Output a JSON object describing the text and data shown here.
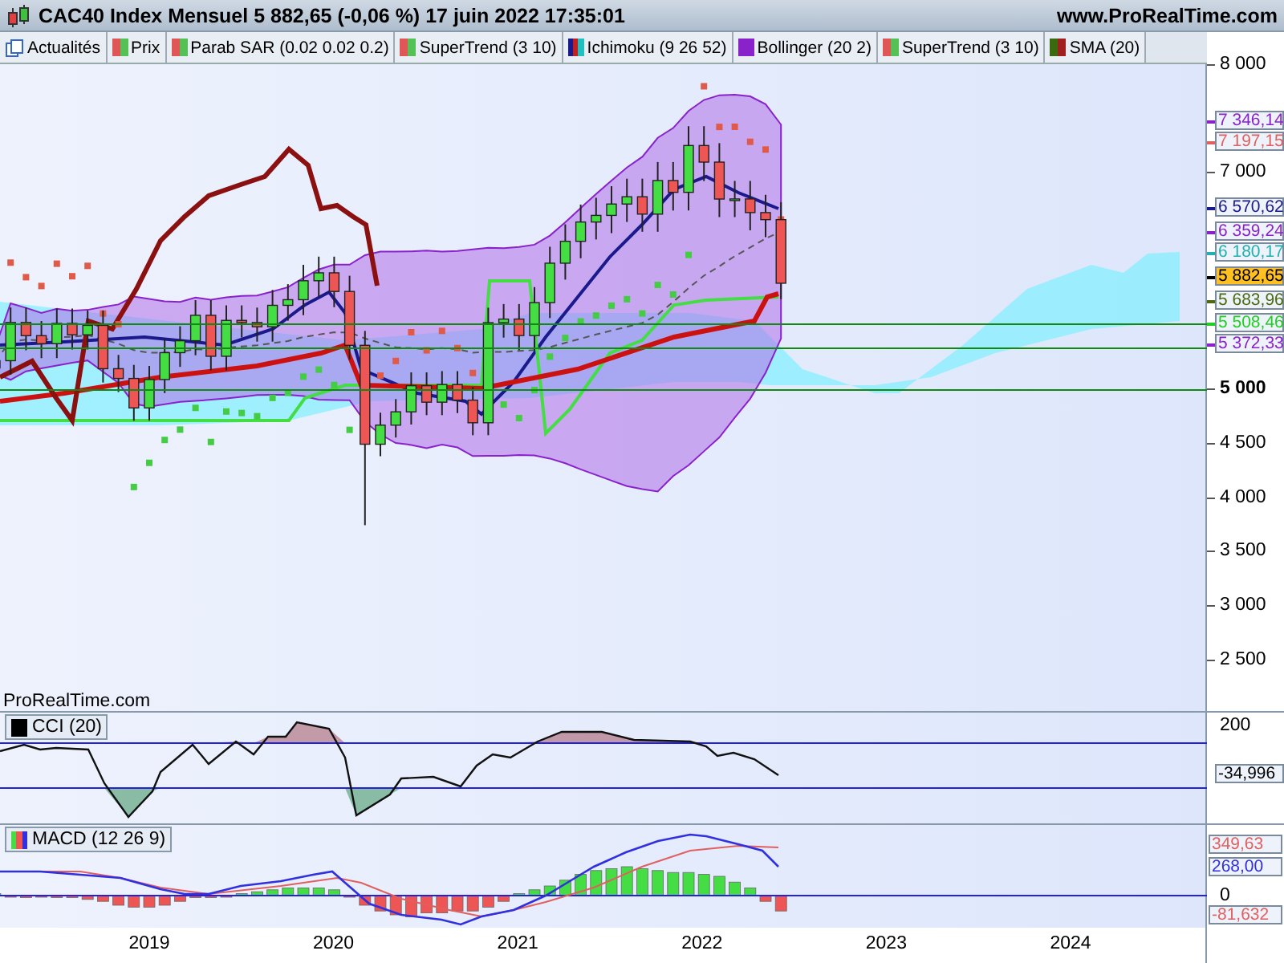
{
  "window": {
    "title": "CAC40 Index Mensuel 5 882,65 (-0,06 %) 17 juin 2022 17:35:01",
    "site": "www.ProRealTime.com"
  },
  "toolbar": {
    "news_button": "Actualités",
    "indicators": [
      {
        "label": "Prix",
        "swatch": [
          {
            "color": "#e05555"
          },
          {
            "color": "#55c055"
          }
        ]
      },
      {
        "label": "Parab SAR (0.02 0.02 0.2)",
        "swatch": [
          {
            "color": "#e05555"
          },
          {
            "color": "#55c055"
          }
        ]
      },
      {
        "label": "SuperTrend (3 10)",
        "swatch": [
          {
            "color": "#e05555"
          },
          {
            "color": "#55c055"
          }
        ]
      },
      {
        "label": "Ichimoku (9 26 52)",
        "swatch": [
          {
            "color": "#1a1a8c"
          },
          {
            "color": "#c02020"
          },
          {
            "color": "#20c0c0"
          }
        ]
      },
      {
        "label": "Bollinger (20 2)",
        "swatch": [
          {
            "color": "#8a22cc"
          }
        ]
      },
      {
        "label": "SuperTrend (3 10)",
        "swatch": [
          {
            "color": "#e05555"
          },
          {
            "color": "#55c055"
          }
        ]
      },
      {
        "label": "SMA (20)",
        "swatch": [
          {
            "color": "#3a6a10"
          },
          {
            "color": "#a02020"
          }
        ]
      }
    ]
  },
  "price_panel": {
    "source_label": "ProRealTime.com",
    "axis_labels": [
      {
        "label": "8 000",
        "bold": false
      },
      {
        "label": "7 000",
        "bold": false
      },
      {
        "label": "5 000",
        "bold": true
      },
      {
        "label": "4 500",
        "bold": false
      },
      {
        "label": "4 000",
        "bold": false
      },
      {
        "label": "3 500",
        "bold": false
      },
      {
        "label": "3 000",
        "bold": false
      },
      {
        "label": "2 500",
        "bold": false
      }
    ],
    "value_tags": [
      {
        "label": "7 346,14",
        "color": "#8a22cc",
        "highlighted": false
      },
      {
        "label": "7 197,15",
        "color": "#e06060",
        "highlighted": false
      },
      {
        "label": "6 570,62",
        "color": "#1a1a8c",
        "highlighted": false
      },
      {
        "label": "6 359,24",
        "color": "#8a22cc",
        "highlighted": false
      },
      {
        "label": "6 180,17",
        "color": "#20b0b0",
        "highlighted": false
      },
      {
        "label": "5 882,65",
        "color": "#000000",
        "highlighted": true
      },
      {
        "label": "5 683,96",
        "color": "#4a6a10",
        "highlighted": false
      },
      {
        "label": "5 508,46",
        "color": "#20d020",
        "highlighted": false
      },
      {
        "label": "5 372,33",
        "color": "#8a22cc",
        "highlighted": false
      }
    ]
  },
  "cci_panel": {
    "legend": "CCI (20)",
    "axis_labels": [
      "200"
    ],
    "value_tag": "-34,996"
  },
  "macd_panel": {
    "legend": "MACD (12 26 9)",
    "axis_labels": [
      "0"
    ],
    "value_tags": [
      {
        "label": "349,63",
        "color": "#e06060"
      },
      {
        "label": "268,00",
        "color": "#3030e0"
      },
      {
        "label": "-81,632",
        "color": "#e06060"
      }
    ]
  },
  "x_axis": [
    "2019",
    "2020",
    "2021",
    "2022",
    "2023",
    "2024"
  ]
}
